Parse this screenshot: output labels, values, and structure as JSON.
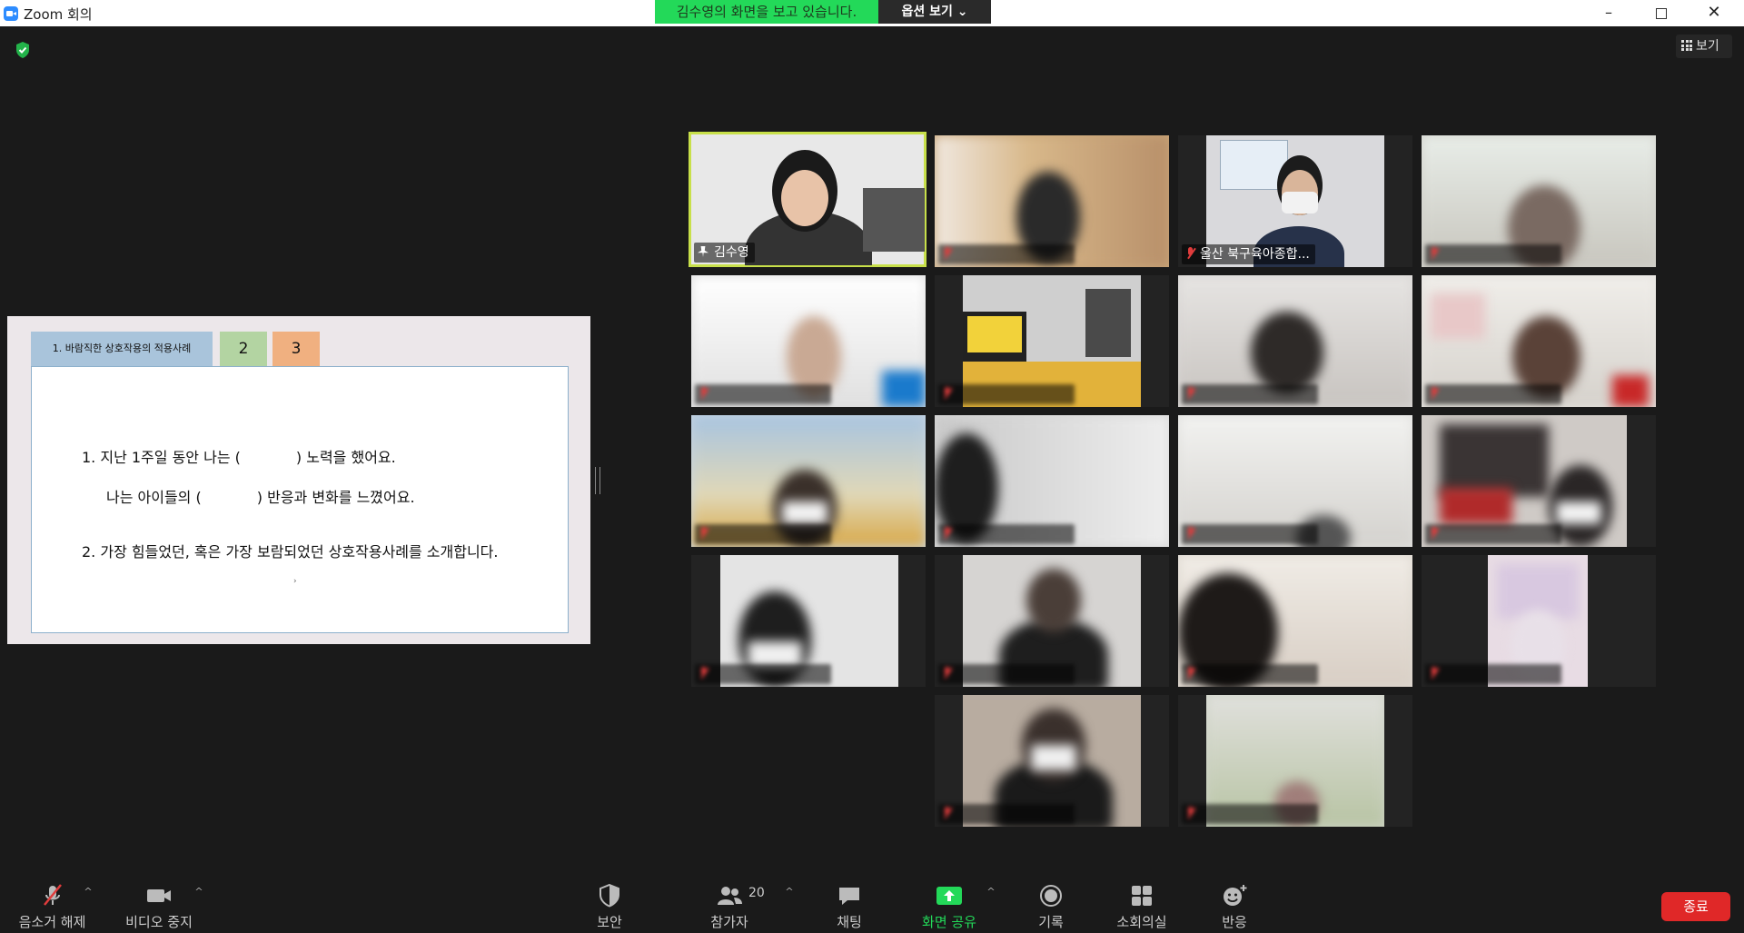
{
  "window": {
    "title": "Zoom 회의",
    "share_banner": "김수영의 화면을 보고 있습니다.",
    "view_options": "옵션 보기 ⌄",
    "minimize": "–",
    "close": "✕"
  },
  "view_toggle": "보기",
  "shared_slide": {
    "tabs": [
      "1. 바람직한 상호작용의 적용사례",
      "2",
      "3"
    ],
    "lines": [
      "1. 지난 1주일 동안 나는 (            ) 노력을 했어요.",
      "나는 아이들의 (            ) 반응과 변화를 느꼈어요.",
      "2. 가장 힘들었던, 혹은 가장 보람되었던 상호작용사례를 소개합니다."
    ]
  },
  "participants": [
    {
      "name": "김수영",
      "muted": false,
      "pinned": true,
      "active": true
    },
    {
      "name": "",
      "muted": true
    },
    {
      "name": "울산 북구육아종합...",
      "muted": true
    },
    {
      "name": "",
      "muted": true
    },
    {
      "name": "",
      "muted": true
    },
    {
      "name": "",
      "muted": true
    },
    {
      "name": "",
      "muted": true
    },
    {
      "name": "",
      "muted": true
    },
    {
      "name": "",
      "muted": true
    },
    {
      "name": "",
      "muted": true
    },
    {
      "name": "",
      "muted": true
    },
    {
      "name": "",
      "muted": true
    },
    {
      "name": "",
      "muted": true
    },
    {
      "name": "",
      "muted": true
    },
    {
      "name": "",
      "muted": true
    },
    {
      "name": "",
      "muted": true
    },
    {
      "name": "",
      "muted": true
    },
    {
      "name": "",
      "muted": true
    }
  ],
  "toolbar": {
    "unmute": "음소거 해제",
    "stop_video": "비디오 중지",
    "security": "보안",
    "participants": "참가자",
    "participants_count": "20",
    "chat": "채팅",
    "share_screen": "화면 공유",
    "record": "기록",
    "breakout": "소회의실",
    "reactions": "반응",
    "end": "종료"
  },
  "colors": {
    "banner_green": "#23d959",
    "active_speaker_border": "#c8e04a",
    "end_red": "#e02828",
    "share_icon_green": "#23d959"
  }
}
